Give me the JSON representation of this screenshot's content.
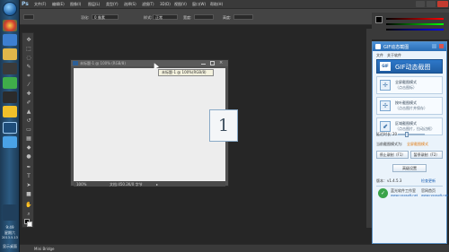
{
  "app": {
    "logo": "Ps",
    "menus": [
      "文件(F)",
      "编辑(E)",
      "图像(I)",
      "图层(L)",
      "类型(Y)",
      "选择(S)",
      "滤镜(T)",
      "3D(D)",
      "视图(V)",
      "窗口(W)",
      "帮助(H)"
    ],
    "options": {
      "feather_label": "羽化:",
      "feather_value": "0 像素",
      "style_label": "样式:",
      "style_value": "正常",
      "width_label": "宽度:",
      "height_label": "高度:"
    },
    "status_left": "Mini Bridge"
  },
  "document": {
    "tab_title": "未标题-1 @ 100% (RGB/8)",
    "tooltip": "未标题-1 @ 100%(RGB/8)",
    "zoom": "100%",
    "doc_size": "文档:450.2K/0 字节"
  },
  "overlay_number": "1",
  "gif_tool": {
    "title": "GIF动态截图",
    "menu": [
      "文件",
      "关于软件"
    ],
    "banner": "GIF动态截图",
    "modes": [
      {
        "line1": "全屏截图模式",
        "line2": "（点击图标）"
      },
      {
        "line1": "按叶截图模式",
        "line2": "（点击图片并保存）"
      },
      {
        "line1": "区域截图模式",
        "line2": "（点击图片，拉动边框）"
      }
    ],
    "delay_label": "延迟时长:",
    "delay_value": "20",
    "current_mode_label": "当前截图模式为:",
    "current_mode_value": "全屏截图模式",
    "stop_button": "停止录制（F1）",
    "pause_button": "暂停录制（F2）",
    "settings_button": "高级设置",
    "version": "版本：v1.4.5.3",
    "update_link": "检查更新",
    "company": "蓝光软件工作室",
    "company_url": "www.rzxxsoft.net",
    "website": "官网首页",
    "website_url": "www.rzxxsoft.net",
    "accent": "#2a6db4"
  },
  "taskbar": {
    "time": "9:49",
    "weekday": "星期六",
    "date": "2013.5.13",
    "label": "显示桌面"
  }
}
